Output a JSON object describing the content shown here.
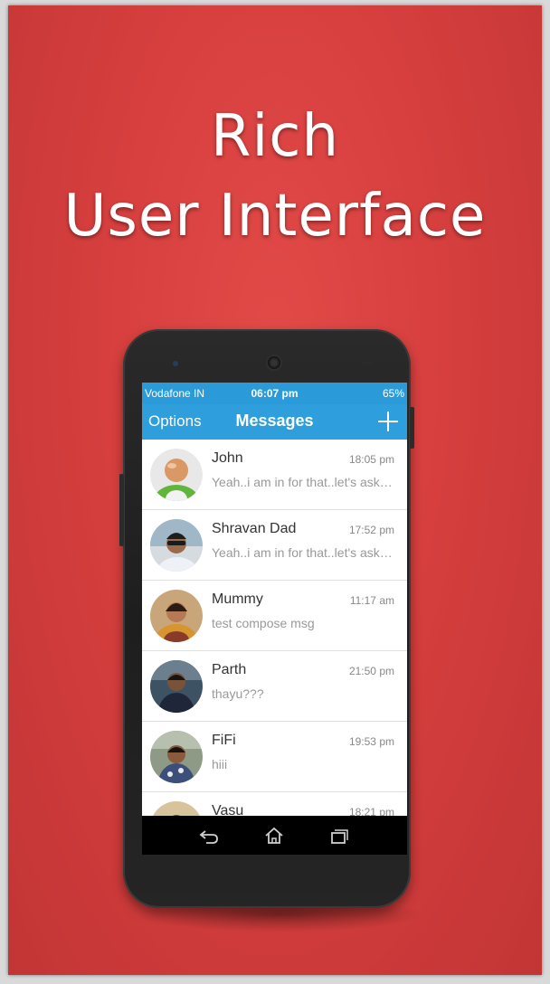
{
  "headline": {
    "line1": "Rich",
    "line2": "User Interface"
  },
  "status_bar": {
    "carrier": "Vodafone IN",
    "time": "06:07 pm",
    "battery": "65%"
  },
  "app_bar": {
    "options_label": "Options",
    "title": "Messages",
    "add_icon": "plus-icon"
  },
  "conversations": [
    {
      "name": "John",
      "time": "18:05 pm",
      "preview": "Yeah..i am in for that..let's ask…",
      "avatar": "default-avatar"
    },
    {
      "name": "Shravan Dad",
      "time": "17:52 pm",
      "preview": "Yeah..i am in for that..let's ask…",
      "avatar": "photo-avatar"
    },
    {
      "name": "Mummy",
      "time": "11:17 am",
      "preview": "test compose msg",
      "avatar": "photo-avatar"
    },
    {
      "name": "Parth",
      "time": "21:50 pm",
      "preview": "thayu???",
      "avatar": "photo-avatar"
    },
    {
      "name": "FiFi",
      "time": "19:53 pm",
      "preview": "hiii",
      "avatar": "photo-avatar"
    },
    {
      "name": "Vasu",
      "time": "18:21 pm",
      "preview": "",
      "avatar": "photo-avatar"
    }
  ],
  "nav_bar": {
    "back_icon": "back-icon",
    "home_icon": "home-icon",
    "recents_icon": "recents-icon"
  },
  "colors": {
    "poster_red": "#d63f3e",
    "app_blue": "#2e9fdc",
    "status_blue": "#2a9bd8"
  }
}
